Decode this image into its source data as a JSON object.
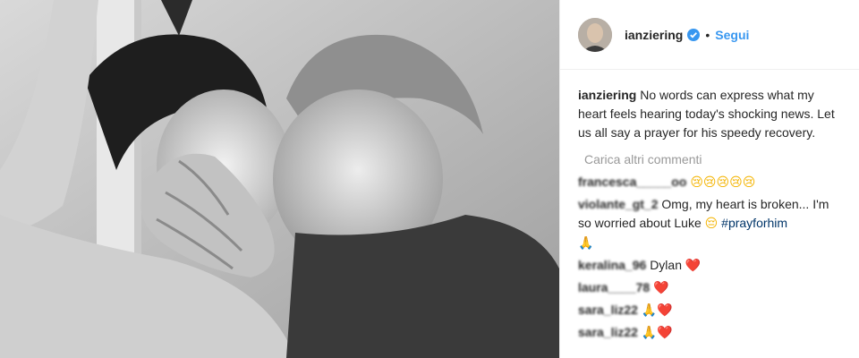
{
  "header": {
    "username": "ianziering",
    "dot": "•",
    "follow_label": "Segui"
  },
  "caption": {
    "user": "ianziering",
    "text": "No words can express what my heart feels hearing today's shocking news. Let us all say a prayer for his speedy recovery."
  },
  "load_more_label": "Carica altri commenti",
  "comments": [
    {
      "user": "francesca_____oo",
      "text": "",
      "emoji": "😢😢😢😢😢"
    },
    {
      "user": "violante_gt_2",
      "text": "Omg, my heart is broken... I'm so worried about Luke",
      "emoji": "😔",
      "hashtag": "#prayforhim",
      "emoji2": "🙏"
    },
    {
      "user": "keralina_96",
      "text": "Dylan",
      "emoji": "❤️"
    },
    {
      "user": "laura____78",
      "text": "",
      "emoji": "❤️"
    },
    {
      "user": "sara_liz22",
      "text": "",
      "emoji": "🙏❤️"
    },
    {
      "user": "sara_liz22",
      "text": "",
      "emoji": "🙏❤️"
    }
  ],
  "colors": {
    "link_blue": "#3897f0",
    "heart_red": "#ed4956",
    "muted_gray": "#999999"
  },
  "icons": {
    "verified": "verified-badge-icon"
  }
}
